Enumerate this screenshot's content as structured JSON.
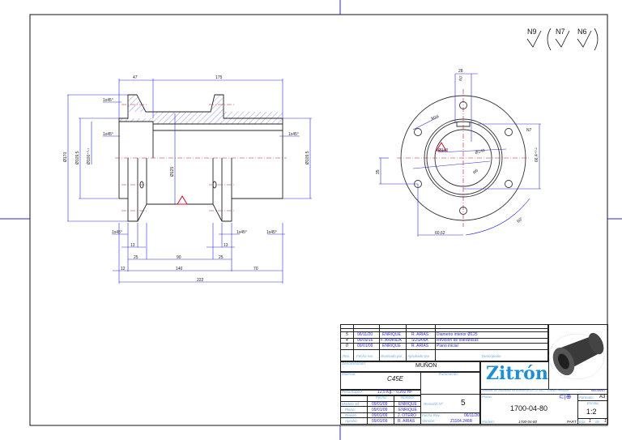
{
  "roughness": {
    "main": "N9",
    "others": [
      "N7",
      "N6"
    ]
  },
  "side_view": {
    "dims": {
      "d47": "47",
      "d175": "175",
      "cham_tl": "1x45°",
      "cham_ml": "1x45°",
      "cham_mr": "1x45°",
      "dia170": "Ø170",
      "dia109": "Ø109,5",
      "dia100": "Ø100⁺⁰·¹",
      "dia125": "Ø125",
      "dia109r": "Ø109,5",
      "cham_b1": "1x45°",
      "cham_b2": "1x45°",
      "cham_b3": "1x45°",
      "d13a": "13",
      "d13b": "13",
      "d25a": "25",
      "d90": "90",
      "d25b": "25",
      "d12": "12",
      "d140": "140",
      "d70": "70",
      "d222": "222"
    }
  },
  "front_view": {
    "dims": {
      "d28": "28",
      "n7a": "N7",
      "n7b": "N7",
      "m16": "M16",
      "dia140i": "Ø140",
      "dia140": "Ø140",
      "r6": "R6",
      "d35": "35",
      "d66": "66,4⁺⁰·²",
      "d60": "60,62",
      "ang": "60°"
    }
  },
  "title_block": {
    "revisions": [
      {
        "rev": "5",
        "date": "06/11/20",
        "reviewed": "ENRIQUE",
        "approved": "R. ARIAS",
        "desc": "Diametro interior Ø125"
      },
      {
        "rev": "4",
        "date": "06/09/16",
        "reviewed": "F. ARANDA",
        "approved": "SUSANA",
        "desc": "Revision de tolerancias"
      },
      {
        "rev": "0",
        "date": "09/01/09",
        "reviewed": "ENRIQUE",
        "approved": "R. ARIAS",
        "desc": "Plano inicial"
      }
    ],
    "headers": {
      "rev": "Rev.",
      "date": "Fecha rev.",
      "reviewed": "Revisado por",
      "approved": "Aprobado por",
      "desc": "Descripción"
    },
    "denominacion_label": "Denominación:",
    "denominacion": "MUÑON",
    "material_label": "Material:",
    "material": "C45E",
    "tratamiento_label": "Tratamiento:",
    "peso_label": "Peso/Superf.:",
    "peso": "12,5 Kg. - 0,202 m²",
    "fecha_label": "Fecha:",
    "nombre_label": "Nombre:",
    "people": [
      {
        "role": "Modelo 3d:",
        "date": "09/01/09",
        "name": "ENRIQUE"
      },
      {
        "role": "Plano:",
        "date": "09/01/09",
        "name": "ENRIQUE"
      },
      {
        "role": "Revisó:",
        "date": "09/01/09",
        "name": "J. OTERO"
      },
      {
        "role": "Aprobó:",
        "date": "09/01/09",
        "name": "R. ARIAS"
      }
    ],
    "revision_label": "Revisión Nº:",
    "revision": "5",
    "fecha_rev_label": "Fecha Rev.:",
    "fecha_rev": "06/11/20",
    "version_label": "Versión:",
    "version": "Z1164.246R",
    "logo": "Zitrón",
    "tolerance_note": "Medidas sin indicación de tolerancia EN 22768-1 · Grado Precisión:",
    "tolerance_grade": "MEDIANO",
    "plano_label": "Plano:",
    "plano": "1700-04-80",
    "modelo_label": "Modelo:",
    "modelo": "1700-04-80",
    "part": "PART",
    "formato_label": "Formato:",
    "formato": "A3",
    "escala_label": "Escala:",
    "escala": "1:2",
    "hoja_label": "Hoja:",
    "hoja": "1",
    "de_label": "de",
    "hoja_total": "1"
  }
}
